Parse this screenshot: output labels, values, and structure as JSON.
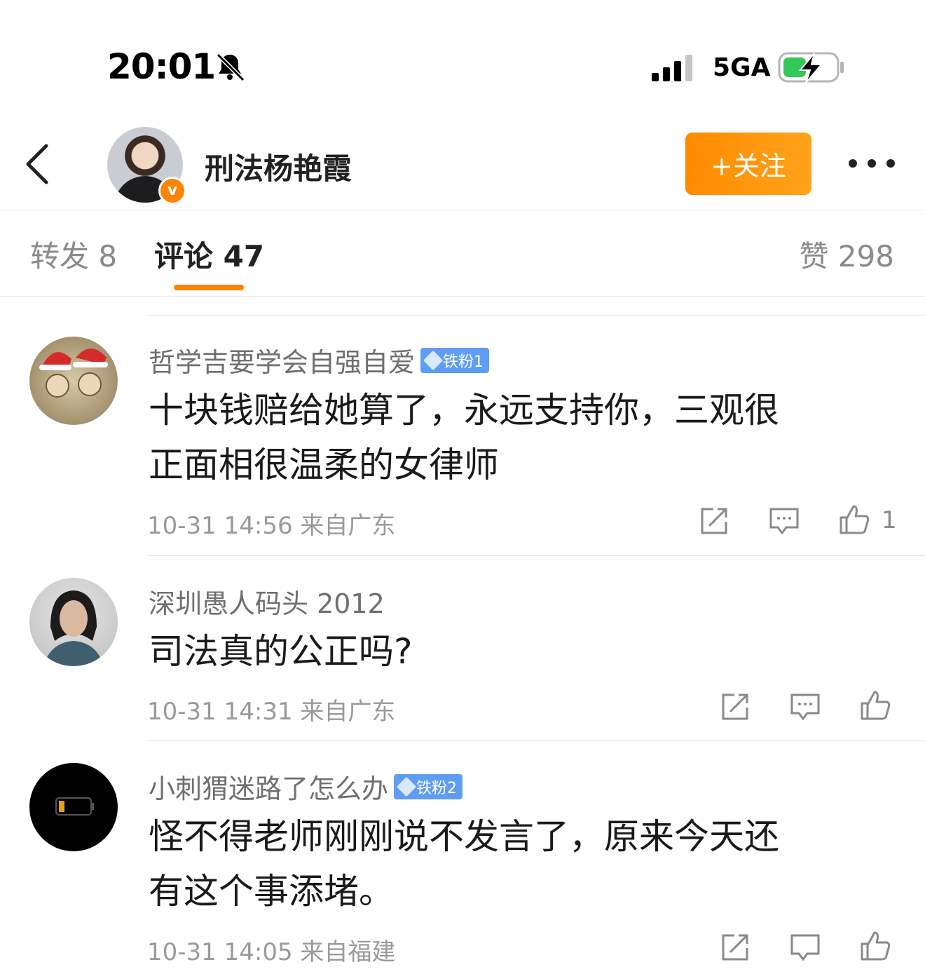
{
  "status_bar": {
    "time": "20:01",
    "network": "5GA",
    "icons": [
      "bell-muted-icon",
      "signal-icon",
      "battery-charging-icon"
    ]
  },
  "header": {
    "back_icon": "chevron-left-icon",
    "username": "刑法杨艳霞",
    "verified_badge": "v",
    "follow_label": "+关注",
    "more_icon": "more-dots-icon"
  },
  "tabs": {
    "forward_label": "转发 8",
    "comment_label": "评论 47",
    "like_label": "赞 298",
    "active": "评论 47",
    "accent": "#ff8200"
  },
  "comments": [
    {
      "user": "哲学吉要学会自强自爱",
      "badge": "铁粉1",
      "text_line1": "十块钱赔给她算了，永远支持你，三观很",
      "text_line2": "正面相很温柔的女律师",
      "time": "10-31 14:56",
      "location": "来自广东",
      "likes": "1"
    },
    {
      "user": "深圳愚人码头 2012",
      "text_line1": "司法真的公正吗?",
      "time": "10-31 14:31",
      "location": "来自广东"
    },
    {
      "user": "小刺猬迷路了怎么办",
      "badge": "铁粉2",
      "text_line1": "怪不得老师刚刚说不发言了，原来今天还",
      "text_line2": "有这个事添堵。",
      "time": "10-31 14:05",
      "location": "来自福建"
    }
  ]
}
